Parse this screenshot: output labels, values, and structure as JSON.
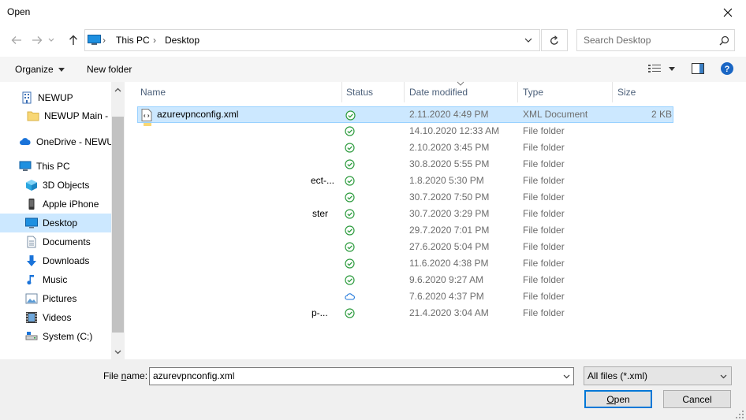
{
  "window": {
    "title": "Open"
  },
  "address": {
    "crumbs": [
      "This PC",
      "Desktop"
    ]
  },
  "search": {
    "placeholder": "Search Desktop"
  },
  "toolbar": {
    "organize": "Organize",
    "new_folder": "New folder"
  },
  "nav": {
    "items": [
      {
        "label": "NEWUP",
        "icon": "building-icon"
      },
      {
        "label": "NEWUP Main - C",
        "icon": "folder-icon"
      },
      {
        "label": "OneDrive - NEWU",
        "icon": "cloud-icon"
      },
      {
        "label": "This PC",
        "icon": "computer-icon"
      },
      {
        "label": "3D Objects",
        "icon": "cube-icon"
      },
      {
        "label": "Apple iPhone",
        "icon": "phone-icon"
      },
      {
        "label": "Desktop",
        "icon": "desktop-icon"
      },
      {
        "label": "Documents",
        "icon": "document-icon"
      },
      {
        "label": "Downloads",
        "icon": "download-icon"
      },
      {
        "label": "Music",
        "icon": "music-icon"
      },
      {
        "label": "Pictures",
        "icon": "picture-icon"
      },
      {
        "label": "Videos",
        "icon": "video-icon"
      },
      {
        "label": "System (C:)",
        "icon": "drive-icon"
      }
    ],
    "selected": "Desktop"
  },
  "columns": {
    "name": "Name",
    "status": "Status",
    "date": "Date modified",
    "type": "Type",
    "size": "Size"
  },
  "files": [
    {
      "name": "azurevpnconfig.xml",
      "status": "synced",
      "date": "2.11.2020 4:49 PM",
      "type": "XML Document",
      "size": "2 KB"
    },
    {
      "name": "",
      "status": "synced",
      "date": "14.10.2020 12:33 AM",
      "type": "File folder",
      "size": ""
    },
    {
      "name": "",
      "status": "synced",
      "date": "2.10.2020 3:45 PM",
      "type": "File folder",
      "size": ""
    },
    {
      "name": "",
      "status": "synced",
      "date": "30.8.2020 5:55 PM",
      "type": "File folder",
      "size": ""
    },
    {
      "name": "ect-...",
      "status": "synced",
      "date": "1.8.2020 5:30 PM",
      "type": "File folder",
      "size": ""
    },
    {
      "name": "",
      "status": "synced",
      "date": "30.7.2020 7:50 PM",
      "type": "File folder",
      "size": ""
    },
    {
      "name": "ster",
      "status": "synced",
      "date": "30.7.2020 3:29 PM",
      "type": "File folder",
      "size": ""
    },
    {
      "name": "",
      "status": "synced",
      "date": "29.7.2020 7:01 PM",
      "type": "File folder",
      "size": ""
    },
    {
      "name": "",
      "status": "synced",
      "date": "27.6.2020 5:04 PM",
      "type": "File folder",
      "size": ""
    },
    {
      "name": "",
      "status": "synced",
      "date": "11.6.2020 4:38 PM",
      "type": "File folder",
      "size": ""
    },
    {
      "name": "",
      "status": "synced",
      "date": "9.6.2020 9:27 AM",
      "type": "File folder",
      "size": ""
    },
    {
      "name": "",
      "status": "cloud",
      "date": "7.6.2020 4:37 PM",
      "type": "File folder",
      "size": ""
    },
    {
      "name": "p-...",
      "status": "synced",
      "date": "21.4.2020 3:04 AM",
      "type": "File folder",
      "size": ""
    }
  ],
  "footer": {
    "filename_label_pre": "File ",
    "filename_label_u": "n",
    "filename_label_post": "ame:",
    "filename_value": "azurevpnconfig.xml",
    "filetype": "All files (*.xml)",
    "open_u": "O",
    "open_rest": "pen",
    "cancel": "Cancel"
  },
  "colors": {
    "accent": "#0078d7",
    "selection": "#cce8ff",
    "sync_green": "#2e9c3f",
    "help_blue": "#1a66c4"
  }
}
